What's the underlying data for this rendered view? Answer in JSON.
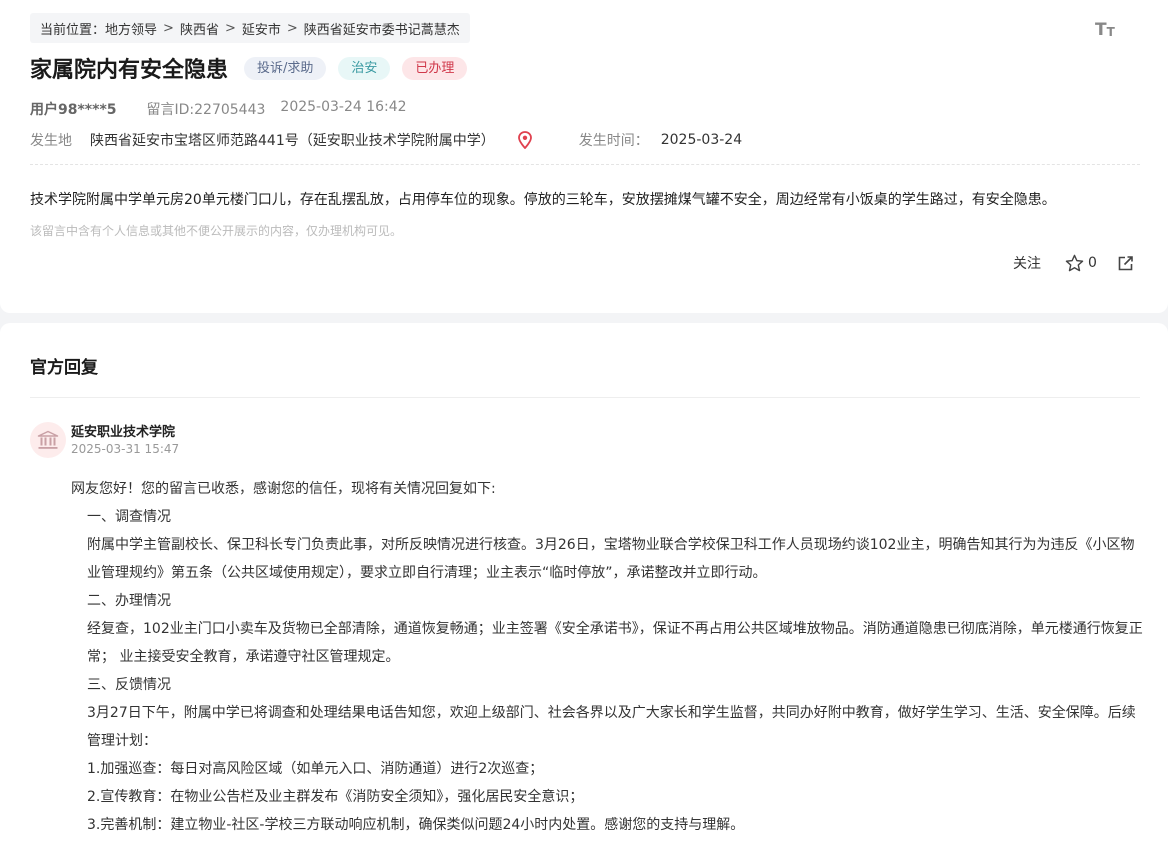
{
  "breadcrumb": {
    "label": "当前位置：",
    "items": [
      "地方领导",
      "陕西省",
      "延安市",
      "陕西省延安市委书记蒿慧杰"
    ],
    "separator": ">"
  },
  "font_toggle": {
    "big": "T",
    "small": "T",
    "icon": "text-size-icon"
  },
  "post": {
    "title": "家属院内有安全隐患",
    "tags": {
      "type": "投诉/求助",
      "category": "治安",
      "status": "已办理"
    },
    "user": "用户98****5",
    "message_id": "留言ID:22705443",
    "post_time": "2025-03-24 16:42",
    "location_label": "发生地",
    "location_value": "陕西省延安市宝塔区师范路441号（延安职业技术学院附属中学）",
    "occur_time_label": "发生时间：",
    "occur_time_value": "2025-03-24",
    "content": "技术学院附属中学单元房20单元楼门口儿，存在乱摆乱放，占用停车位的现象。停放的三轮车，安放摆摊煤气罐不安全，周边经常有小饭桌的学生路过，有安全隐患。",
    "privacy_note": "该留言中含有个人信息或其他不便公开展示的内容，仅办理机构可见。"
  },
  "actions": {
    "follow": "关注",
    "favorite_count": "0"
  },
  "reply": {
    "heading": "官方回复",
    "org_name": "延安职业技术学院",
    "date": "2025-03-31 15:47",
    "paragraphs": [
      {
        "text": "网友您好！您的留言已收悉，感谢您的信任，现将有关情况回复如下:",
        "indent": false
      },
      {
        "text": "一、调查情况",
        "indent": true
      },
      {
        "text": "附属中学主管副校长、保卫科长专门负责此事，对所反映情况进行核查。3月26日，宝塔物业联合学校保卫科工作人员现场约谈102业主，明确告知其行为为违反《小区物业管理规约》第五条（公共区域使用规定），要求立即自行清理；业主表示“临时停放”，承诺整改并立即行动。",
        "indent": true
      },
      {
        "text": "二、办理情况",
        "indent": true
      },
      {
        "text": "经复查，102业主门口小卖车及货物已全部清除，通道恢复畅通；业主签署《安全承诺书》，保证不再占用公共区域堆放物品。消防通道隐患已彻底消除，单元楼通行恢复正常； 业主接受安全教育，承诺遵守社区管理规定。",
        "indent": true
      },
      {
        "text": "三、反馈情况",
        "indent": true
      },
      {
        "text": "3月27日下午，附属中学已将调查和处理结果电话告知您，欢迎上级部门、社会各界以及广大家长和学生监督，共同办好附中教育，做好学生学习、生活、安全保障。后续管理计划：",
        "indent": true
      },
      {
        "text": "1.加强巡查：每日对高风险区域（如单元入口、消防通道）进行2次巡查；",
        "indent": true
      },
      {
        "text": "2.宣传教育：在物业公告栏及业主群发布《消防安全须知》，强化居民安全意识；",
        "indent": true
      },
      {
        "text": "3.完善机制：建立物业-社区-学校三方联动响应机制，确保类似问题24小时内处置。感谢您的支持与理解。",
        "indent": true
      }
    ]
  },
  "colors": {
    "status_red": "#d0384a",
    "pin_red": "#e0414f",
    "avatar_bg": "#fdecec",
    "avatar_icon": "#c9a0a5"
  }
}
